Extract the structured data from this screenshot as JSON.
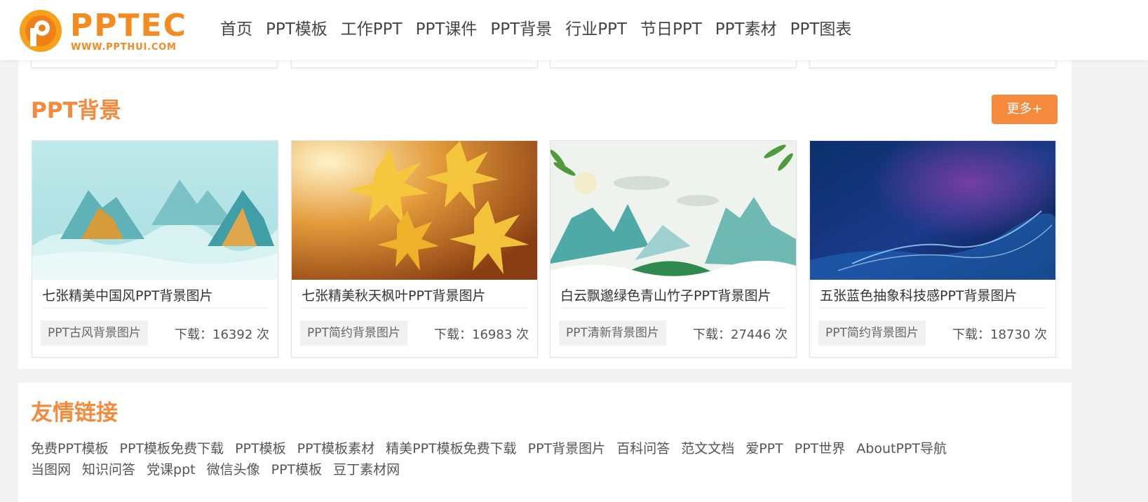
{
  "logo": {
    "text": "PPTEC",
    "url": "WWW.PPTHUI.COM"
  },
  "nav": [
    {
      "label": "首页"
    },
    {
      "label": "PPT模板"
    },
    {
      "label": "工作PPT"
    },
    {
      "label": "PPT课件"
    },
    {
      "label": "PPT背景"
    },
    {
      "label": "行业PPT"
    },
    {
      "label": "节日PPT"
    },
    {
      "label": "PPT素材"
    },
    {
      "label": "PPT图表"
    }
  ],
  "section": {
    "title": "PPT背景",
    "more_label": "更多+"
  },
  "cards": [
    {
      "title": "七张精美中国风PPT背景图片",
      "tag": "PPT古风背景图片",
      "downloads": "下载：16392 次",
      "thumb": "chinese-landscape"
    },
    {
      "title": "七张精美秋天枫叶PPT背景图片",
      "tag": "PPT简约背景图片",
      "downloads": "下载：16983 次",
      "thumb": "autumn-maple-leaves"
    },
    {
      "title": "白云飘邈绿色青山竹子PPT背景图片",
      "tag": "PPT清新背景图片",
      "downloads": "下载：27446 次",
      "thumb": "green-mountains-bamboo"
    },
    {
      "title": "五张蓝色抽象科技感PPT背景图片",
      "tag": "PPT简约背景图片",
      "downloads": "下载：18730 次",
      "thumb": "blue-abstract-tech"
    }
  ],
  "friend_links": {
    "title": "友情链接",
    "items": [
      "免费PPT模板",
      "PPT模板免费下载",
      "PPT模板",
      "PPT模板素材",
      "精美PPT模板免费下载",
      "PPT背景图片",
      "百科问答",
      "范文文档",
      "爱PPT",
      "PPT世界",
      "AboutPPT导航",
      "当图网",
      "知识问答",
      "党课ppt",
      "微信头像",
      "PPT模板",
      "豆丁素材网"
    ]
  },
  "colors": {
    "accent": "#f58a3c",
    "logo": "#f58a1f"
  }
}
